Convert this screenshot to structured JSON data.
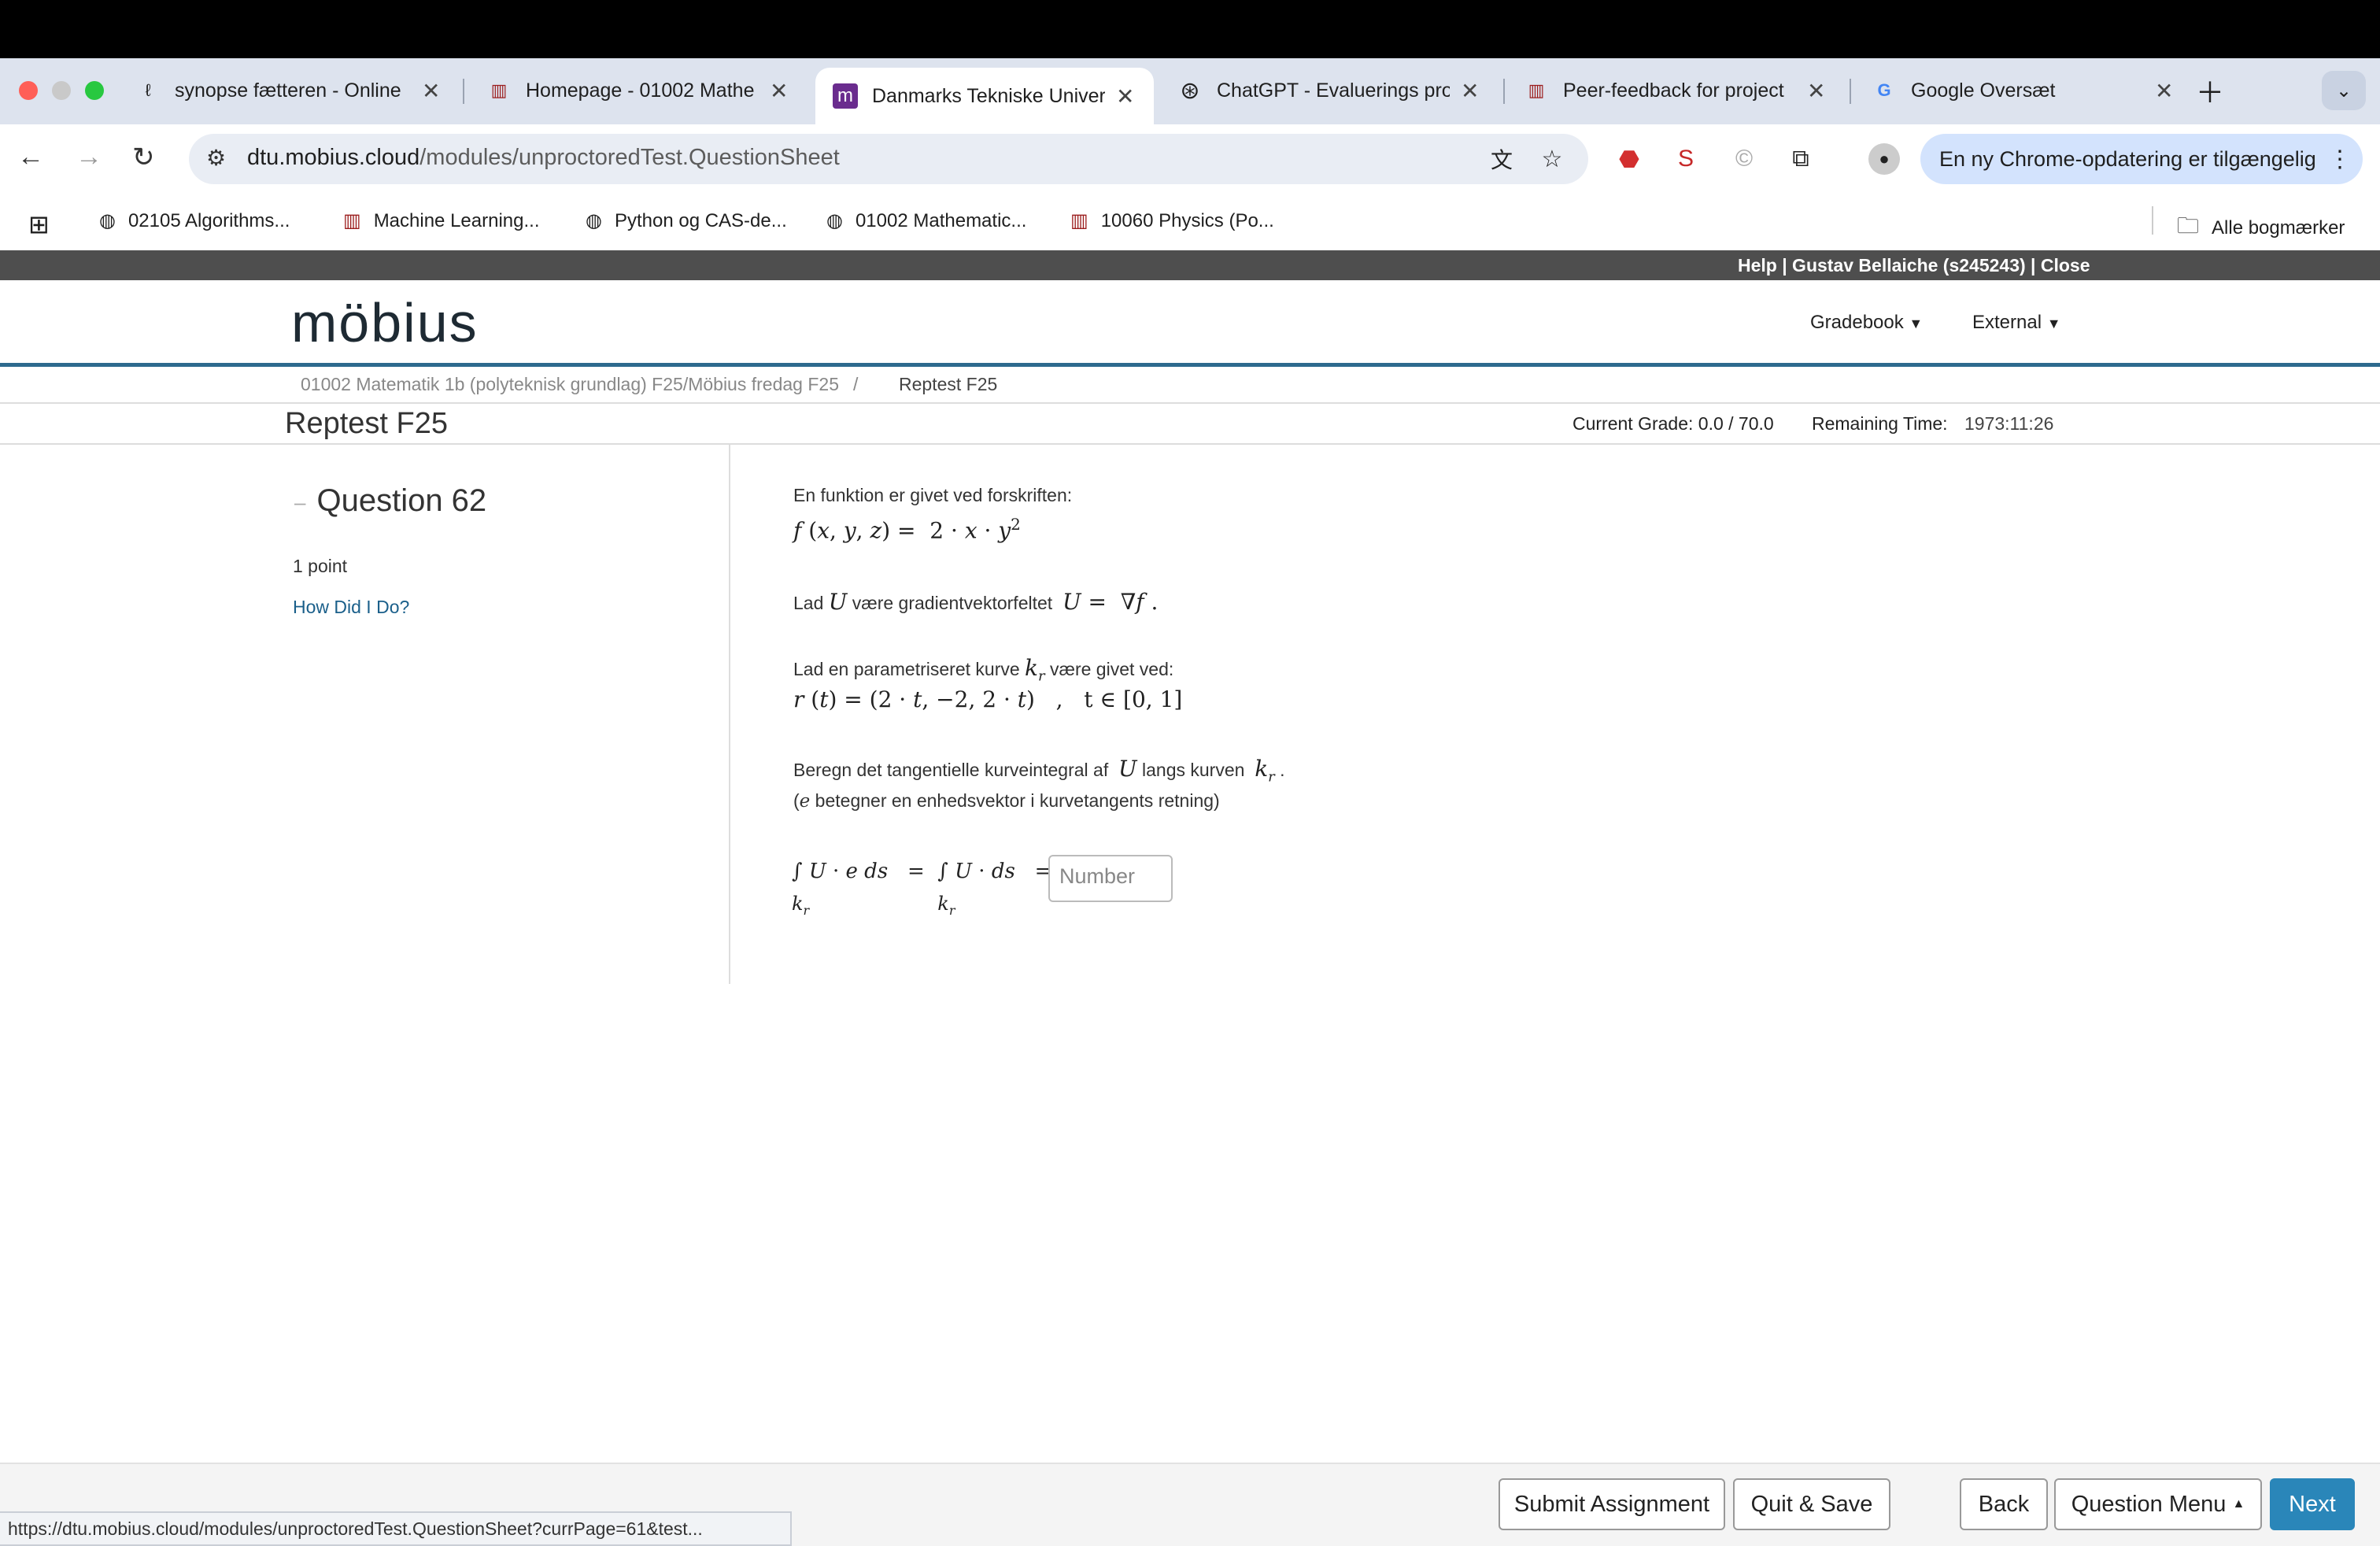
{
  "browser": {
    "tabs": [
      {
        "title": "synopse fætteren - Online",
        "icon": "o"
      },
      {
        "title": "Homepage - 01002 Mathe",
        "icon": "dtu"
      },
      {
        "title": "Danmarks Tekniske Univer",
        "icon": "m"
      },
      {
        "title": "ChatGPT - Evaluerings pro",
        "icon": "gpt"
      },
      {
        "title": "Peer-feedback for project",
        "icon": "dtu"
      },
      {
        "title": "Google Oversæt",
        "icon": "translate"
      }
    ],
    "url_host": "dtu.mobius.cloud",
    "url_path": "/modules/unproctoredTest.QuestionSheet",
    "update_label": "En ny Chrome-opdatering er tilgængelig",
    "bookmarks": [
      "02105 Algorithms...",
      "Machine Learning...",
      "Python og CAS-de...",
      "01002 Mathematic...",
      "10060 Physics (Po..."
    ],
    "all_bookmarks": "Alle bogmærker",
    "status_url": "https://dtu.mobius.cloud/modules/unproctoredTest.QuestionSheet?currPage=61&test..."
  },
  "topbar": {
    "user_links": "Help | Gustav Bellaiche (s245243) | Close"
  },
  "header": {
    "logo": "möbius",
    "menu": [
      "Gradebook",
      "External"
    ]
  },
  "breadcrumb": {
    "course": "01002 Matematik 1b (polyteknisk grundlag) F25/Möbius fredag F25",
    "current": "Reptest F25"
  },
  "page": {
    "title": "Reptest F25",
    "grade_label": "Current Grade: 0.0 / 70.0",
    "time_label": "Remaining Time:",
    "time_value": "1973:11:26"
  },
  "question": {
    "title": "Question 62",
    "points": "1 point",
    "how_link": "How Did I Do?",
    "intro": "En funktion er givet ved forskriften:",
    "line2_pre": "Lad",
    "line2_mid": "være gradientvektorfeltet",
    "line3_pre": "Lad en parametriseret kurve",
    "line3_post": "være givet ved:",
    "line4_pre": "Beregn det tangentielle kurveintegral af",
    "line4_mid": "langs kurven",
    "line5_pre": "(",
    "line5_post": " betegner en enhedsvektor i kurvetangents retning)",
    "answer_placeholder": "Number"
  },
  "footer": {
    "buttons": [
      "Submit Assignment",
      "Quit & Save",
      "Back",
      "Question Menu",
      "Next"
    ]
  }
}
